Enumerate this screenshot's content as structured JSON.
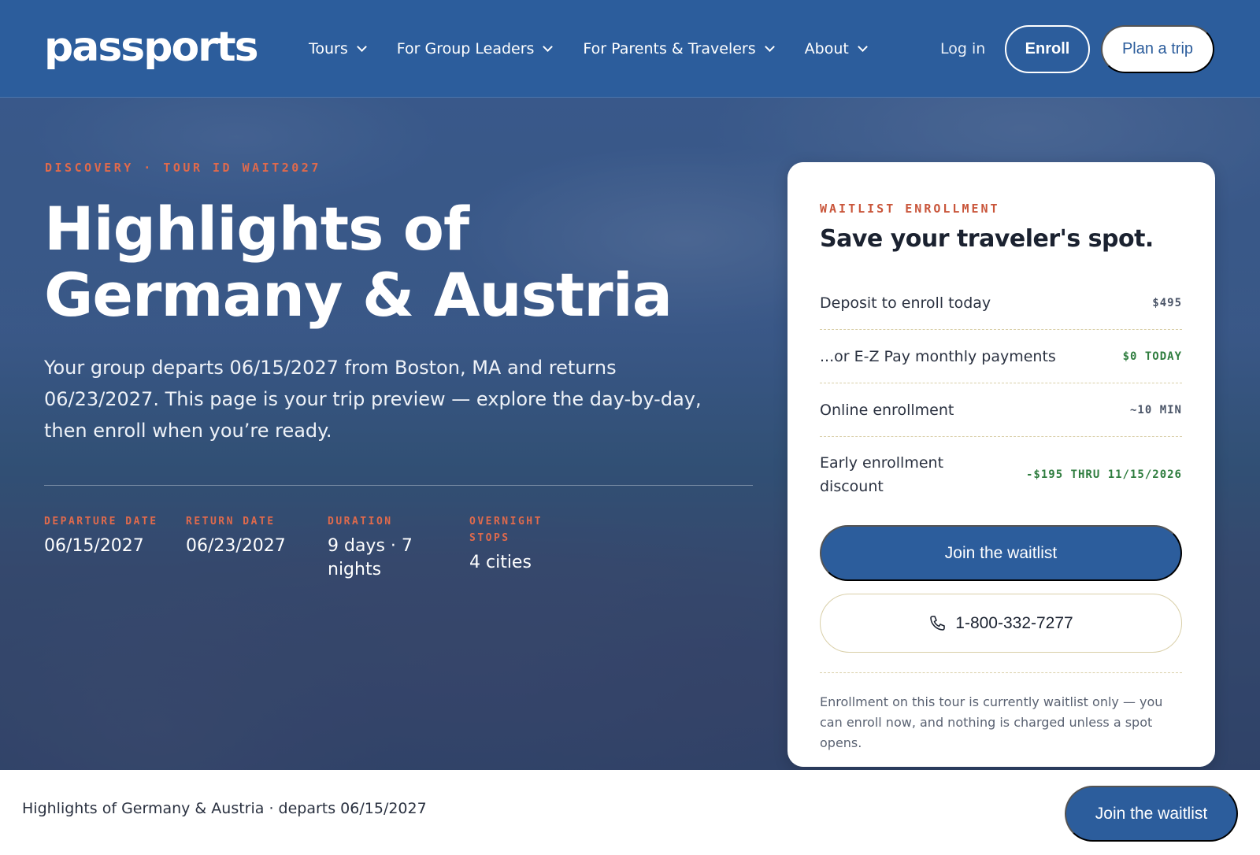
{
  "nav": {
    "logo": "passports",
    "links": [
      {
        "label": "Tours"
      },
      {
        "label": "For Group Leaders"
      },
      {
        "label": "For Parents & Travelers"
      },
      {
        "label": "About"
      }
    ],
    "login_label": "Log in",
    "enroll_label": "Enroll",
    "plan_label": "Plan a trip"
  },
  "hero": {
    "eyebrow": "DISCOVERY · TOUR ID WAIT2027",
    "title_line1": "Highlights of",
    "title_line2": "Germany & Austria",
    "description": "Your group departs 06/15/2027 from Boston, MA and returns 06/23/2027. This page is your trip preview — explore the day-by-day, then enroll when you’re ready.",
    "stats": [
      {
        "label": "DEPARTURE DATE",
        "value": "06/15/2027"
      },
      {
        "label": "RETURN DATE",
        "value": "06/23/2027"
      },
      {
        "label": "DURATION",
        "value": "9 days · 7 nights"
      },
      {
        "label": "OVERNIGHT STOPS",
        "value": "4 cities"
      }
    ]
  },
  "card": {
    "eyebrow": "WAITLIST ENROLLMENT",
    "title": "Save your traveler's spot.",
    "rows": [
      {
        "label": "Deposit to enroll today",
        "value": "$495"
      },
      {
        "label": "...or E-Z Pay monthly payments",
        "value": "$0 TODAY"
      },
      {
        "label": "Online enrollment",
        "value": "~10 MIN"
      },
      {
        "label": "Early enrollment discount",
        "value": "-$195 THRU 11/15/2026"
      }
    ],
    "join_label": "Join the waitlist",
    "phone": "1-800-332-7277",
    "note": "Enrollment on this tour is currently waitlist only — you can enroll now, and nothing is charged unless a spot opens."
  },
  "bottom": {
    "text": "Highlights of Germany & Austria · departs 06/15/2027",
    "join_label": "Join the waitlist"
  },
  "colors": {
    "brand_blue": "#2c5d9c",
    "accent_orange": "#e06a4c",
    "discount_green": "#2f7d3f"
  }
}
